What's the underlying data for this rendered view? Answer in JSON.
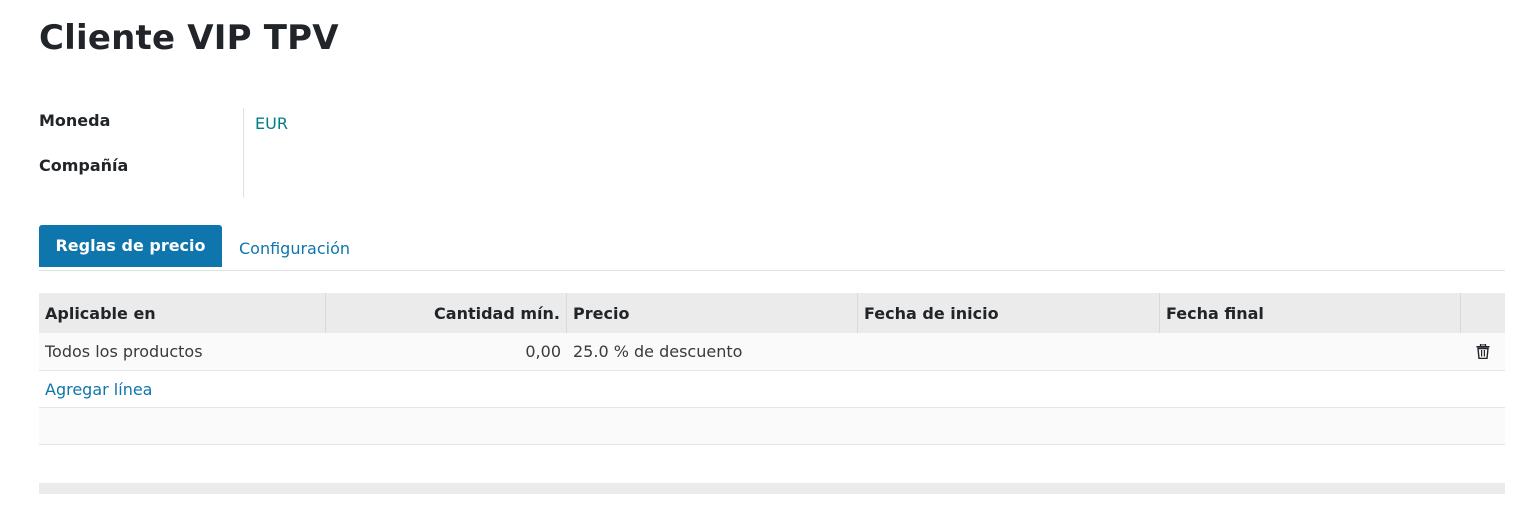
{
  "record": {
    "title": "Cliente VIP TPV"
  },
  "fields": {
    "currency_label": "Moneda",
    "currency_value": "EUR",
    "company_label": "Compañía",
    "company_value": ""
  },
  "tabs": [
    {
      "label": "Reglas de precio",
      "active": true
    },
    {
      "label": "Configuración",
      "active": false
    }
  ],
  "table": {
    "columns": [
      "Aplicable en",
      "Cantidad mín.",
      "Precio",
      "Fecha de inicio",
      "Fecha final"
    ],
    "rows": [
      {
        "applies_to": "Todos los productos",
        "min_qty": "0,00",
        "price": "25.0 % de descuento",
        "start_date": "",
        "end_date": "",
        "action_icon": "trash-icon"
      }
    ],
    "add_line_label": "Agregar línea"
  },
  "colors": {
    "accent": "#0f75ad",
    "link": "#017e84",
    "header_bg": "#ebebeb"
  }
}
